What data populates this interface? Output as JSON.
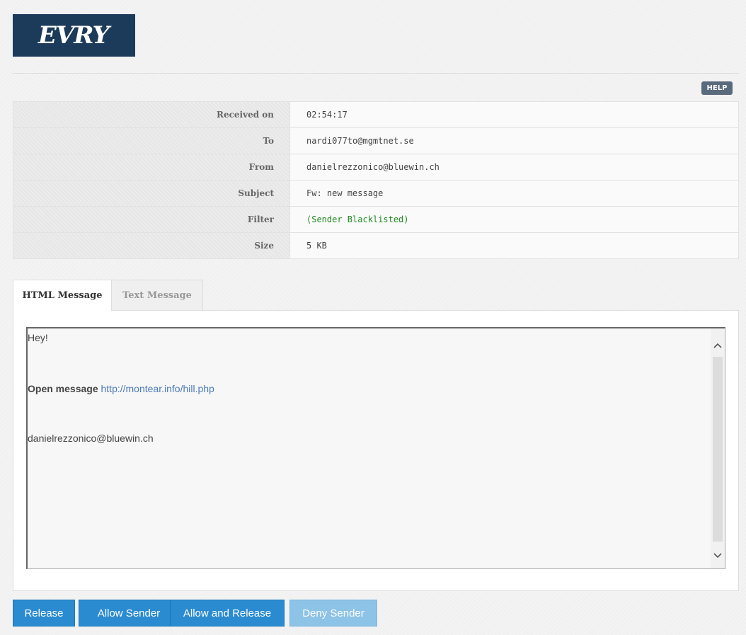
{
  "brand": {
    "logo_text": "EVRY",
    "logo_bg": "#1c3b5a"
  },
  "header": {
    "help_label": "HELP"
  },
  "details": [
    {
      "label": "Received on",
      "value": "02:54:17"
    },
    {
      "label": "To",
      "value": "nardi077to@mgmtnet.se"
    },
    {
      "label": "From",
      "value": "danielrezzonico@bluewin.ch"
    },
    {
      "label": "Subject",
      "value": "Fw: new message"
    },
    {
      "label": "Filter",
      "value": "(Sender Blacklisted)",
      "value_color": "#1e8a1e"
    },
    {
      "label": "Size",
      "value": "5 KB"
    }
  ],
  "tabs": [
    {
      "label": "HTML Message",
      "active": true
    },
    {
      "label": "Text Message",
      "active": false
    }
  ],
  "message": {
    "greeting": "Hey!",
    "open_label": "Open message",
    "link_text": "http://montear.info/hill.php",
    "signature": "danielrezzonico@bluewin.ch"
  },
  "icons": {
    "scroll_up": "chevron-up-icon",
    "scroll_down": "chevron-down-icon"
  },
  "actions": {
    "release": "Release",
    "allow_sender": "Allow Sender",
    "allow_and_release": "Allow and Release",
    "deny_sender": "Deny Sender",
    "primary_color": "#2a8bd0",
    "disabled_color": "#8cc3e6"
  }
}
